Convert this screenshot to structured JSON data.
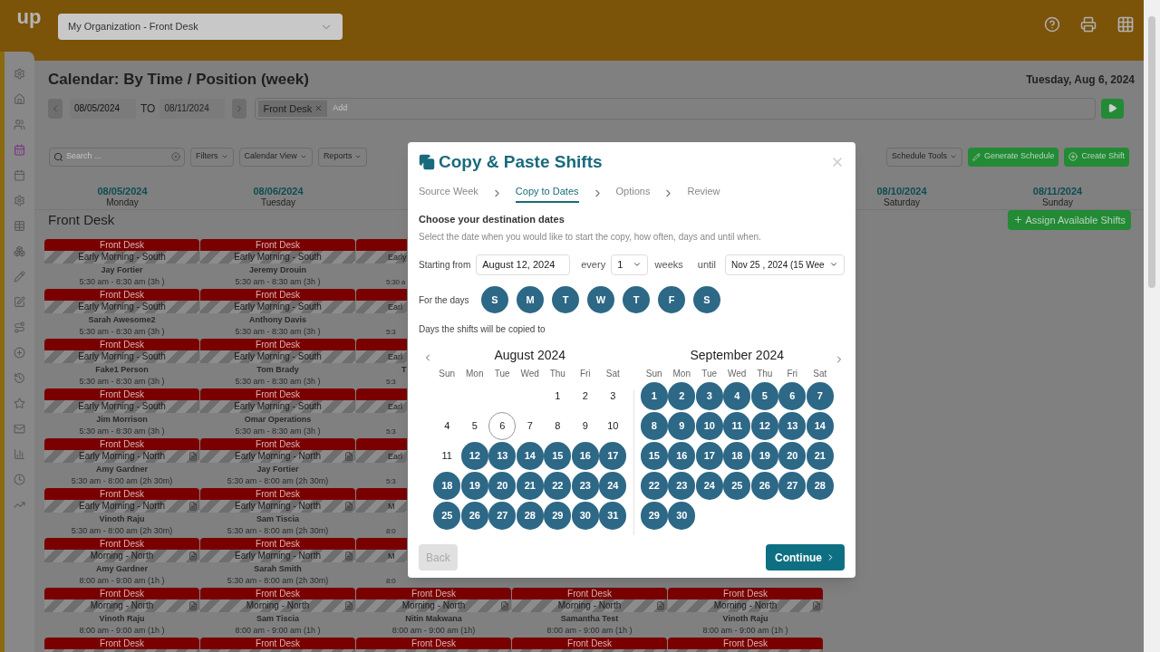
{
  "header": {
    "logo": "up",
    "organization": "My Organization - Front Desk"
  },
  "sidebar": {
    "items": [
      {
        "selected": false
      },
      {
        "selected": false
      },
      {
        "selected": false
      },
      {
        "selected": true
      },
      {
        "selected": false
      },
      {
        "selected": false
      },
      {
        "selected": false
      },
      {
        "selected": false
      },
      {
        "selected": false
      },
      {
        "selected": false
      },
      {
        "selected": false
      },
      {
        "selected": false
      },
      {
        "selected": false
      },
      {
        "selected": false
      },
      {
        "selected": false
      },
      {
        "selected": false
      },
      {
        "selected": false
      },
      {
        "selected": false
      }
    ]
  },
  "page": {
    "title": "Calendar: By Time / Position (week)",
    "today": "Tuesday, Aug 6, 2024",
    "from": "08/05/2024",
    "to_label": "TO",
    "to": "08/11/2024",
    "filter_tag": "Front Desk",
    "filter_placeholder": "Add"
  },
  "toolbar": {
    "search_placeholder": "Search ...",
    "left_buttons": [
      "Filters",
      "Calendar View",
      "Reports"
    ],
    "schedule_tools": "Schedule Tools",
    "generate": "Generate Schedule",
    "create": "Create Shift"
  },
  "days": [
    {
      "date": "08/05/2024",
      "weekday": "Monday"
    },
    {
      "date": "08/06/2024",
      "weekday": "Tuesday"
    },
    {
      "date": "08/10/2024",
      "weekday": "Saturday"
    },
    {
      "date": "08/11/2024",
      "weekday": "Sunday"
    }
  ],
  "section": {
    "title": "Front Desk",
    "assign": "Assign Available Shifts"
  },
  "rows": [
    {
      "cells": [
        {
          "kind": "full",
          "header": "Front Desk",
          "position": "Early Morning - South",
          "name": "Jay Fortier",
          "time": "5:30 am - 8:30 am (3h )",
          "note": false
        },
        {
          "kind": "full",
          "header": "Front Desk",
          "position": "Early Morning - South",
          "name": "Jeremy Drouin",
          "time": "5:30 am - 8:30 am (3h )",
          "note": false
        },
        {
          "kind": "partial",
          "position": "Early",
          "time": "5:30 a"
        }
      ]
    },
    {
      "cells": [
        {
          "kind": "full",
          "header": "Front Desk",
          "position": "Early Morning - South",
          "name": "Sarah Awesome2",
          "time": "5:30 am - 8:30 am (3h )",
          "note": false
        },
        {
          "kind": "full",
          "header": "Front Desk",
          "position": "Early Morning - South",
          "name": "Anthony Davis",
          "time": "5:30 am - 8:30 am (3h )",
          "note": false
        },
        {
          "kind": "partial",
          "position": "Earl",
          "time": "5:3"
        }
      ]
    },
    {
      "cells": [
        {
          "kind": "full",
          "header": "Front Desk",
          "position": "Early Morning - South",
          "name": "Fake1 Person",
          "time": "5:30 am - 8:30 am (3h )",
          "note": false
        },
        {
          "kind": "full",
          "header": "Front Desk",
          "position": "Early Morning - South",
          "name": "Tom Brady",
          "time": "5:30 am - 8:30 am (3h )",
          "note": false
        },
        {
          "kind": "partial",
          "position": "Earl",
          "name": "T",
          "time": "5:3"
        }
      ]
    },
    {
      "cells": [
        {
          "kind": "full",
          "header": "Front Desk",
          "position": "Early Morning - South",
          "name": "Jim Morrison",
          "time": "5:30 am - 8:30 am (3h )",
          "note": false
        },
        {
          "kind": "full",
          "header": "Front Desk",
          "position": "Early Morning - South",
          "name": "Omar Operations",
          "time": "5:30 am - 8:30 am (3h )",
          "note": false
        },
        {
          "kind": "partial",
          "position": "Earl",
          "time": "5:3"
        }
      ]
    },
    {
      "cells": [
        {
          "kind": "full",
          "header": "Front Desk",
          "position": "Early Morning - North",
          "name": "Amy Gardner",
          "time": "5:30 am - 8:00 am (2h 30m)",
          "note": true
        },
        {
          "kind": "full",
          "header": "Front Desk",
          "position": "Early Morning - North",
          "name": "Jay Fortier",
          "time": "5:30 am - 8:00 am (2h 30m)",
          "note": true
        },
        {
          "kind": "partial",
          "position": "Earl",
          "time": "5:3"
        }
      ]
    },
    {
      "cells": [
        {
          "kind": "full",
          "header": "Front Desk",
          "position": "Early Morning - North",
          "name": "Vinoth Raju",
          "time": "5:30 am - 8:00 am (2h 30m)",
          "note": true
        },
        {
          "kind": "full",
          "header": "Front Desk",
          "position": "Early Morning - North",
          "name": "Sam Tiscia",
          "time": "5:30 am - 8:00 am (2h 30m)",
          "note": true
        },
        {
          "kind": "partial",
          "position": "M",
          "time": "8:0"
        }
      ]
    },
    {
      "cells": [
        {
          "kind": "full",
          "header": "Front Desk",
          "position": "Morning - North",
          "name": "Amy Gardner",
          "time": "8:00 am - 9:00 am (1h )",
          "note": true
        },
        {
          "kind": "full",
          "header": "Front Desk",
          "position": "Early Morning - North",
          "name": "Sarah Smith",
          "time": "5:30 am - 8:00 am (2h 30m)",
          "note": true
        },
        {
          "kind": "partial",
          "position": "M",
          "time": "8:0"
        }
      ]
    },
    {
      "cells": [
        {
          "kind": "full",
          "header": "Front Desk",
          "position": "Morning - North",
          "name": "Vinoth Raju",
          "time": "8:00 am - 9:00 am (1h )",
          "note": true
        },
        {
          "kind": "full",
          "header": "Front Desk",
          "position": "Morning - North",
          "name": "Sam Tiscia",
          "time": "8:00 am - 9:00 am (1h )",
          "note": true
        },
        {
          "kind": "full",
          "header": "Front Desk",
          "position": "Morning - North",
          "name": "Nitin Makwana",
          "time": "8:00 am - 9:00 am (1h)",
          "note": true
        },
        {
          "kind": "full",
          "header": "Front Desk",
          "position": "Morning - North",
          "name": "Samantha Test",
          "time": "8:00 am - 9:00 am (1h )",
          "note": true
        },
        {
          "kind": "full",
          "header": "Front Desk",
          "position": "Morning - North",
          "name": "Vinoth Raju",
          "time": "8:00 am - 9:00 am (1h )",
          "note": true
        }
      ]
    },
    {
      "cells": [
        {
          "kind": "header_only",
          "header": "Front Desk"
        },
        {
          "kind": "header_only",
          "header": "Front Desk"
        },
        {
          "kind": "header_only",
          "header": "Front Desk"
        },
        {
          "kind": "header_only",
          "header": "Front Desk"
        },
        {
          "kind": "header_only",
          "header": "Front Desk"
        }
      ]
    }
  ],
  "dialog": {
    "title": "Copy & Paste Shifts",
    "steps": [
      {
        "label": "Source Week",
        "selected": false
      },
      {
        "label": "Copy to Dates",
        "selected": true
      },
      {
        "label": "Options",
        "selected": false
      },
      {
        "label": "Review",
        "selected": false
      }
    ],
    "heading": "Choose your destination dates",
    "description": "Select the date when you would like to start the copy, how often, days and until when.",
    "starting_label": "Starting from",
    "starting_value": "August 12, 2024",
    "every_label": "every",
    "every_value": "1",
    "weeks_label": "weeks",
    "until_label": "until",
    "until_value": "Nov 25 , 2024 (15 Wee",
    "days_label": "For the days",
    "weekdays": [
      {
        "label": "S",
        "selected": true
      },
      {
        "label": "M",
        "selected": true
      },
      {
        "label": "T",
        "selected": true
      },
      {
        "label": "W",
        "selected": true
      },
      {
        "label": "T",
        "selected": true
      },
      {
        "label": "F",
        "selected": true
      },
      {
        "label": "S",
        "selected": true
      }
    ],
    "copied_label": "Days the shifts will be copied to",
    "months": [
      {
        "title": "August 2024",
        "weekday_headers": [
          "Sun",
          "Mon",
          "Tue",
          "Wed",
          "Thu",
          "Fri",
          "Sat"
        ],
        "weeks": [
          [
            {
              "day": "1",
              "selected": false,
              "today": false
            },
            {
              "day": "2",
              "selected": false,
              "today": false
            },
            {
              "day": "3",
              "selected": false,
              "today": false
            }
          ],
          [
            {
              "day": "4",
              "selected": false,
              "today": false
            },
            {
              "day": "5",
              "selected": false,
              "today": false
            },
            {
              "day": "6",
              "selected": false,
              "today": true
            },
            {
              "day": "7",
              "selected": false,
              "today": false
            },
            {
              "day": "8",
              "selected": false,
              "today": false
            },
            {
              "day": "9",
              "selected": false,
              "today": false
            },
            {
              "day": "10",
              "selected": false,
              "today": false
            }
          ],
          [
            {
              "day": "11",
              "selected": false,
              "today": false
            },
            {
              "day": "12",
              "selected": true,
              "today": false
            },
            {
              "day": "13",
              "selected": true,
              "today": false
            },
            {
              "day": "14",
              "selected": true,
              "today": false
            },
            {
              "day": "15",
              "selected": true,
              "today": false
            },
            {
              "day": "16",
              "selected": true,
              "today": false
            },
            {
              "day": "17",
              "selected": true,
              "today": false
            }
          ],
          [
            {
              "day": "18",
              "selected": true,
              "today": false
            },
            {
              "day": "19",
              "selected": true,
              "today": false
            },
            {
              "day": "20",
              "selected": true,
              "today": false
            },
            {
              "day": "21",
              "selected": true,
              "today": false
            },
            {
              "day": "22",
              "selected": true,
              "today": false
            },
            {
              "day": "23",
              "selected": true,
              "today": false
            },
            {
              "day": "24",
              "selected": true,
              "today": false
            }
          ],
          [
            {
              "day": "25",
              "selected": true,
              "today": false
            },
            {
              "day": "26",
              "selected": true,
              "today": false
            },
            {
              "day": "27",
              "selected": true,
              "today": false
            },
            {
              "day": "28",
              "selected": true,
              "today": false
            },
            {
              "day": "29",
              "selected": true,
              "today": false
            },
            {
              "day": "30",
              "selected": true,
              "today": false
            },
            {
              "day": "31",
              "selected": true,
              "today": false
            }
          ]
        ]
      },
      {
        "title": "September 2024",
        "weekday_headers": [
          "Sun",
          "Mon",
          "Tue",
          "Wed",
          "Thu",
          "Fri",
          "Sat"
        ],
        "weeks": [
          [
            {
              "day": "1",
              "selected": true,
              "today": false
            },
            {
              "day": "2",
              "selected": true,
              "today": false
            },
            {
              "day": "3",
              "selected": true,
              "today": false
            },
            {
              "day": "4",
              "selected": true,
              "today": false
            },
            {
              "day": "5",
              "selected": true,
              "today": false
            },
            {
              "day": "6",
              "selected": true,
              "today": false
            },
            {
              "day": "7",
              "selected": true,
              "today": false
            }
          ],
          [
            {
              "day": "8",
              "selected": true,
              "today": false
            },
            {
              "day": "9",
              "selected": true,
              "today": false
            },
            {
              "day": "10",
              "selected": true,
              "today": false
            },
            {
              "day": "11",
              "selected": true,
              "today": false
            },
            {
              "day": "12",
              "selected": true,
              "today": false
            },
            {
              "day": "13",
              "selected": true,
              "today": false
            },
            {
              "day": "14",
              "selected": true,
              "today": false
            }
          ],
          [
            {
              "day": "15",
              "selected": true,
              "today": false
            },
            {
              "day": "16",
              "selected": true,
              "today": false
            },
            {
              "day": "17",
              "selected": true,
              "today": false
            },
            {
              "day": "18",
              "selected": true,
              "today": false
            },
            {
              "day": "19",
              "selected": true,
              "today": false
            },
            {
              "day": "20",
              "selected": true,
              "today": false
            },
            {
              "day": "21",
              "selected": true,
              "today": false
            }
          ],
          [
            {
              "day": "22",
              "selected": true,
              "today": false
            },
            {
              "day": "23",
              "selected": true,
              "today": false
            },
            {
              "day": "24",
              "selected": true,
              "today": false
            },
            {
              "day": "25",
              "selected": true,
              "today": false
            },
            {
              "day": "26",
              "selected": true,
              "today": false
            },
            {
              "day": "27",
              "selected": true,
              "today": false
            },
            {
              "day": "28",
              "selected": true,
              "today": false
            }
          ],
          [
            {
              "day": "29",
              "selected": true,
              "today": false
            },
            {
              "day": "30",
              "selected": true,
              "today": false
            }
          ]
        ]
      }
    ],
    "back": "Back",
    "back_disabled": true,
    "continue": "Continue"
  }
}
